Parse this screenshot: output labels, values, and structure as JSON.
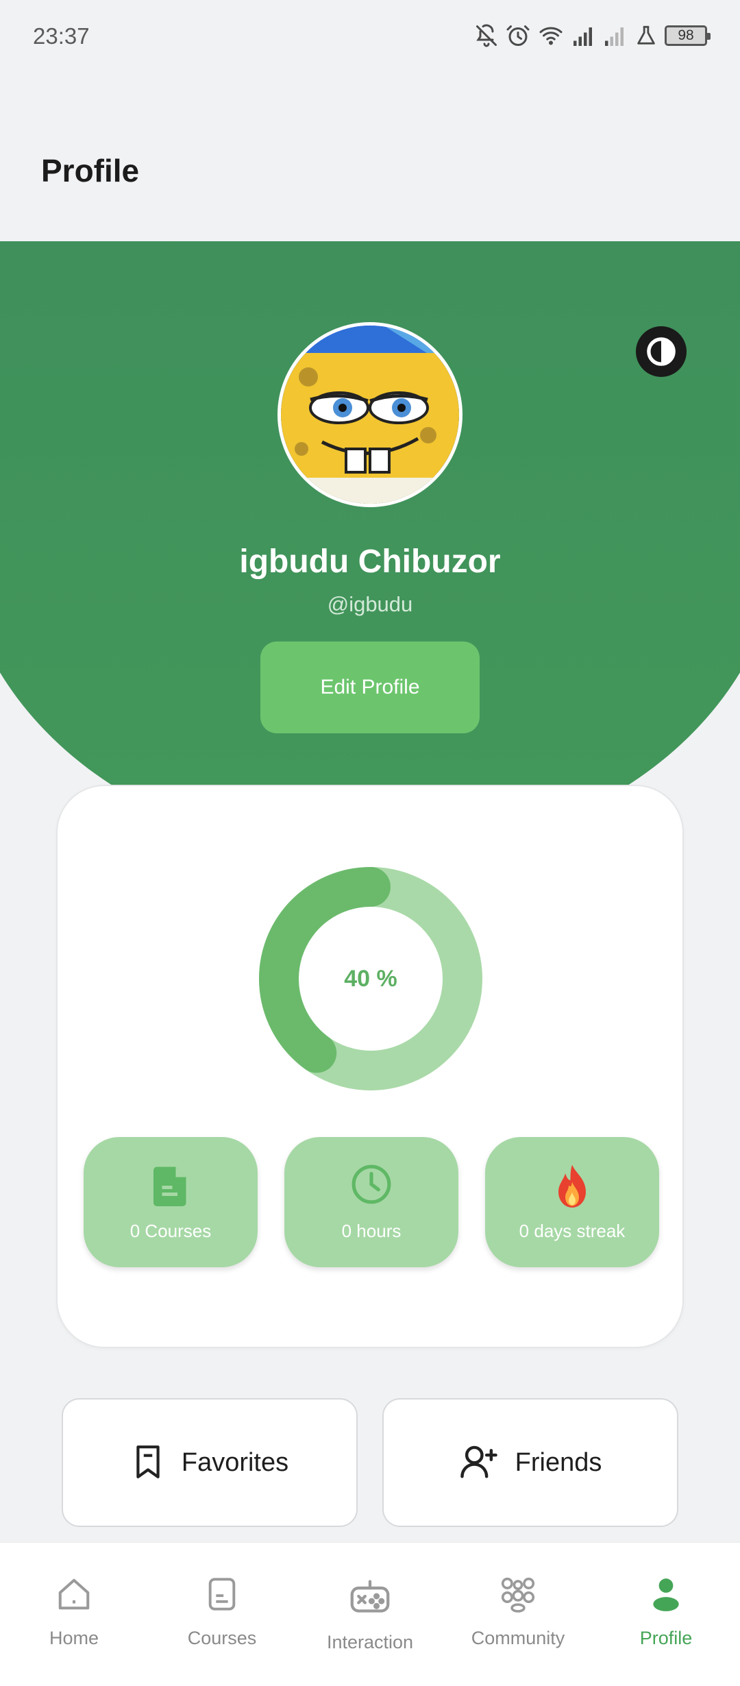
{
  "status_bar": {
    "time": "23:37",
    "battery": "98",
    "icons": [
      "bell-off-icon",
      "alarm-icon",
      "wifi-icon",
      "signal-icon",
      "signal-weak-icon",
      "flask-icon",
      "battery-icon"
    ]
  },
  "header": {
    "title": "Profile"
  },
  "profile": {
    "name": "igbudu Chibuzor",
    "handle": "@igbudu",
    "edit_label": "Edit Profile",
    "theme_toggle_icon": "contrast-icon"
  },
  "stats": {
    "progress_percent": 40,
    "progress_label": "40 %",
    "tiles": [
      {
        "icon": "document-icon",
        "label": "0 Courses"
      },
      {
        "icon": "clock-icon",
        "label": "0 hours"
      },
      {
        "icon": "fire-icon",
        "label": "0 days streak"
      }
    ]
  },
  "actions": {
    "favorites_label": "Favorites",
    "friends_label": "Friends"
  },
  "nav": {
    "items": [
      {
        "label": "Home",
        "icon": "home-icon",
        "active": false
      },
      {
        "label": "Courses",
        "icon": "courses-icon",
        "active": false
      },
      {
        "label": "Interaction",
        "icon": "gamepad-icon",
        "active": false
      },
      {
        "label": "Community",
        "icon": "community-icon",
        "active": false
      },
      {
        "label": "Profile",
        "icon": "user-icon",
        "active": true
      }
    ]
  },
  "colors": {
    "hero_green": "#3f935a",
    "accent_green": "#6cc56d",
    "tile_green": "#a6d8a5",
    "progress_fill": "#6bba6c",
    "progress_track": "#a9d9a8",
    "active_nav": "#45a557"
  }
}
